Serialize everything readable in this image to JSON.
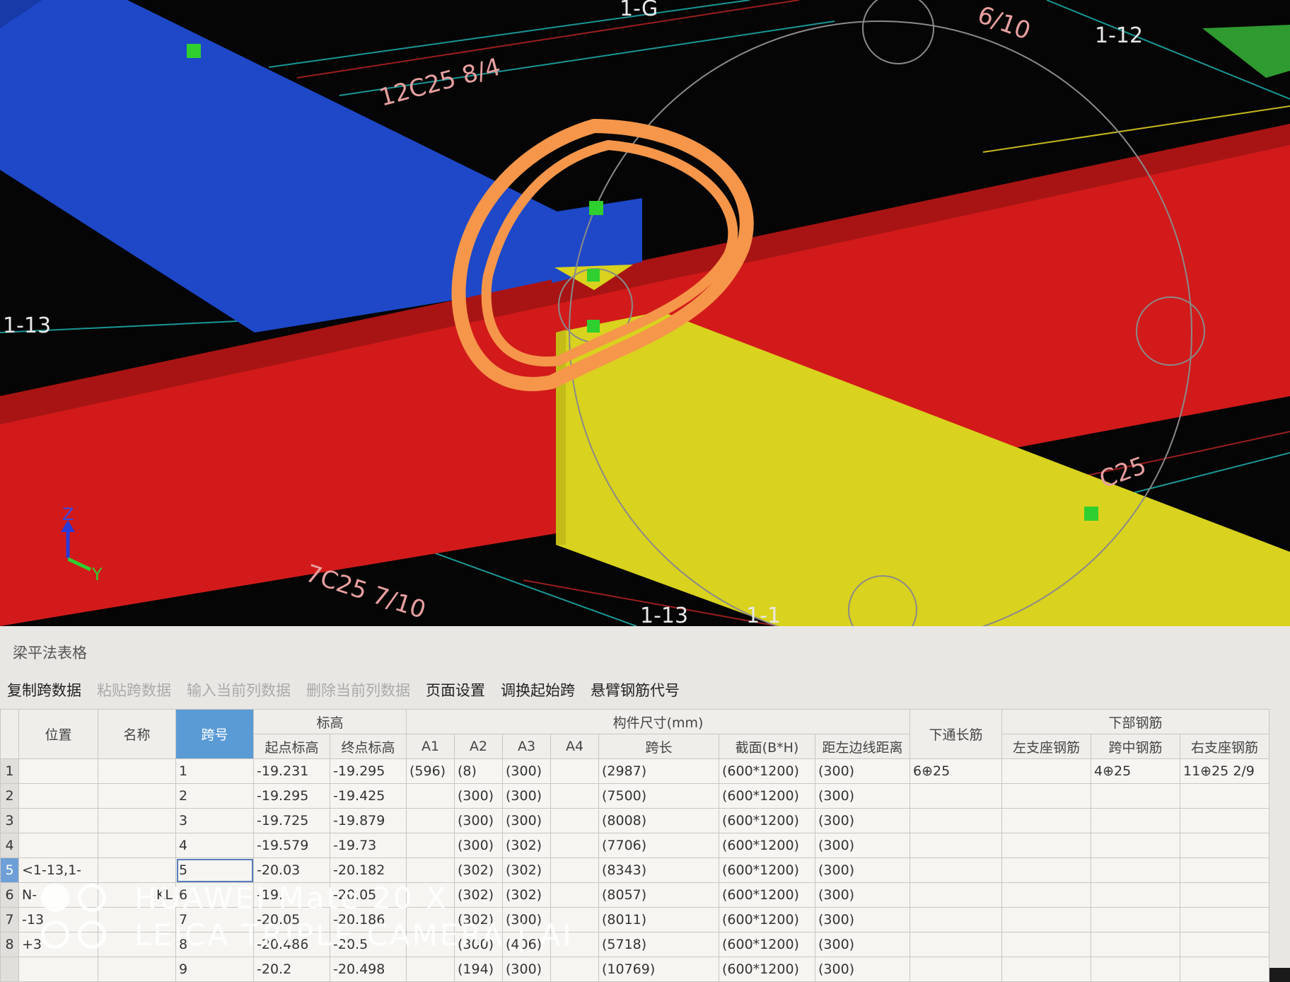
{
  "viewport": {
    "grid_labels": [
      "1-G",
      "1-12",
      "1-13",
      "1-13",
      "1-1"
    ],
    "rebar_labels": [
      "12C25 8/4",
      "7C25 7/10",
      "C25",
      "6/10"
    ],
    "axis": {
      "z": "Z",
      "y": "Y"
    },
    "colors": {
      "blue_beam": "#1e48c8",
      "red_beam": "#d21a1a",
      "yellow_beam": "#d9d21e",
      "highlight": "#f5964a",
      "grip": "#2fcf2f"
    }
  },
  "panel": {
    "title": "梁平法表格",
    "toolbar": {
      "copy_span": "复制跨数据",
      "paste_span": "粘贴跨数据",
      "input_column": "输入当前列数据",
      "delete_column": "删除当前列数据",
      "page_setup": "页面设置",
      "swap_start": "调换起始跨",
      "cantilever_code": "悬臂钢筋代号"
    },
    "headers": {
      "position": "位置",
      "name": "名称",
      "span_no": "跨号",
      "elevation": "标高",
      "start_elev": "起点标高",
      "end_elev": "终点标高",
      "member_size": "构件尺寸(mm)",
      "a1": "A1",
      "a2": "A2",
      "a3": "A3",
      "a4": "A4",
      "span_len": "跨长",
      "section": "截面(B*H)",
      "dist_left": "距左边线距离",
      "bottom_through": "下通长筋",
      "bottom_rebar": "下部钢筋",
      "left_support": "左支座钢筋",
      "mid_span": "跨中钢筋",
      "right_support": "右支座钢筋"
    },
    "row_nums": [
      "1",
      "2",
      "3",
      "4",
      "5",
      "6",
      "7",
      "8"
    ],
    "position_text": [
      "<1-13,1-",
      "N-",
      "-13",
      "+3"
    ],
    "name_text": "KL",
    "rows": [
      {
        "span": "1",
        "start": "-19.231",
        "end": "-19.295",
        "a1": "(596)",
        "a2": "(8)",
        "a3": "(300)",
        "len": "(2987)",
        "sec": "(600*1200)",
        "dist": "(300)",
        "through": "6⊕25",
        "mid": "4⊕25",
        "right": "11⊕25 2/9"
      },
      {
        "span": "2",
        "start": "-19.295",
        "end": "-19.425",
        "a1": "",
        "a2": "(300)",
        "a3": "(300)",
        "len": "(7500)",
        "sec": "(600*1200)",
        "dist": "(300)",
        "through": "",
        "mid": "",
        "right": ""
      },
      {
        "span": "3",
        "start": "-19.725",
        "end": "-19.879",
        "a1": "",
        "a2": "(300)",
        "a3": "(300)",
        "len": "(8008)",
        "sec": "(600*1200)",
        "dist": "(300)",
        "through": "",
        "mid": "",
        "right": ""
      },
      {
        "span": "4",
        "start": "-19.579",
        "end": "-19.73",
        "a1": "",
        "a2": "(300)",
        "a3": "(302)",
        "len": "(7706)",
        "sec": "(600*1200)",
        "dist": "(300)",
        "through": "",
        "mid": "",
        "right": ""
      },
      {
        "span": "5",
        "start": "-20.03",
        "end": "-20.182",
        "a1": "",
        "a2": "(302)",
        "a3": "(302)",
        "len": "(8343)",
        "sec": "(600*1200)",
        "dist": "(300)",
        "through": "",
        "mid": "",
        "right": ""
      },
      {
        "span": "6",
        "start": "-19.",
        "end": "-20.05",
        "a1": "",
        "a2": "(302)",
        "a3": "(302)",
        "len": "(8057)",
        "sec": "(600*1200)",
        "dist": "(300)",
        "through": "",
        "mid": "",
        "right": ""
      },
      {
        "span": "7",
        "start": "-20.05",
        "end": "-20.186",
        "a1": "",
        "a2": "(302)",
        "a3": "(300)",
        "len": "(8011)",
        "sec": "(600*1200)",
        "dist": "(300)",
        "through": "",
        "mid": "",
        "right": ""
      },
      {
        "span": "8",
        "start": "-20.486",
        "end": "-20.5",
        "a1": "",
        "a2": "(300)",
        "a3": "(406)",
        "len": "(5718)",
        "sec": "(600*1200)",
        "dist": "(300)",
        "through": "",
        "mid": "",
        "right": ""
      },
      {
        "span": "9",
        "start": "-20.2",
        "end": "-20.498",
        "a1": "",
        "a2": "(194)",
        "a3": "(300)",
        "len": "(10769)",
        "sec": "(600*1200)",
        "dist": "(300)",
        "through": "",
        "mid": "",
        "right": ""
      }
    ]
  },
  "watermark": {
    "line1": "HUAWEI Mate 20 X",
    "line2": "LEICA TRIPLE CAMERA | AI"
  }
}
